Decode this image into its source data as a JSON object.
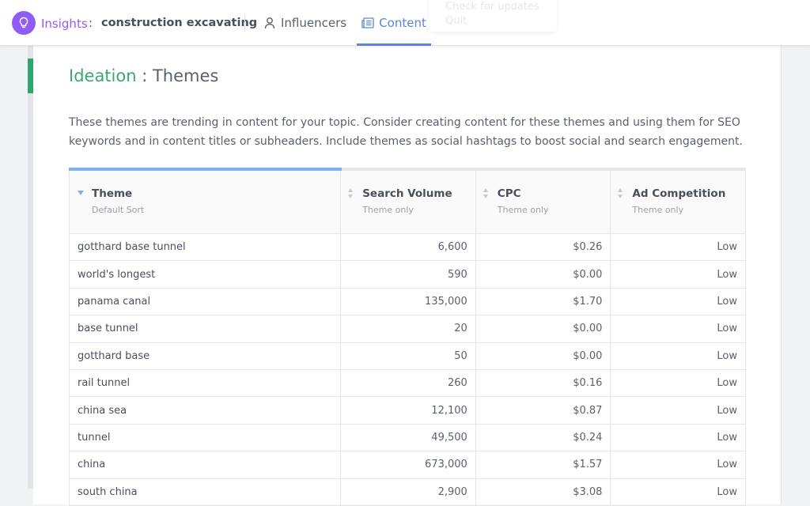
{
  "nav": {
    "app_name": "Insights",
    "separator": ":",
    "topic": "construction excavating",
    "tabs": [
      {
        "label": "Influencers",
        "icon": "person-icon",
        "active": false
      },
      {
        "label": "Content",
        "icon": "article-icon",
        "active": true
      }
    ],
    "ghost_menu": [
      "Check for updates",
      "Quit"
    ],
    "brand_color": "#8f5cf6",
    "active_color": "#5b86d6"
  },
  "section": {
    "title_prefix": "Ideation",
    "title_separator": " : ",
    "title": "Themes",
    "prefix_color": "#3aa876",
    "description": "These themes are trending in content for your topic. Consider creating content for these themes and using them for SEO keywords and in content titles or subheaders. Include themes as social hashtags to boost social and search engagement."
  },
  "table": {
    "columns": [
      {
        "label": "Theme",
        "sub": "Default Sort",
        "sort": "descending-active"
      },
      {
        "label": "Search Volume",
        "sub": "Theme only",
        "sort": "none"
      },
      {
        "label": "CPC",
        "sub": "Theme only",
        "sort": "none"
      },
      {
        "label": "Ad Competition",
        "sub": "Theme only",
        "sort": "none"
      }
    ],
    "rows": [
      [
        "gotthard base tunnel",
        "6,600",
        "$0.26",
        "Low"
      ],
      [
        "world's longest",
        "590",
        "$0.00",
        "Low"
      ],
      [
        "panama canal",
        "135,000",
        "$1.70",
        "Low"
      ],
      [
        "base tunnel",
        "20",
        "$0.00",
        "Low"
      ],
      [
        "gotthard base",
        "50",
        "$0.00",
        "Low"
      ],
      [
        "rail tunnel",
        "260",
        "$0.16",
        "Low"
      ],
      [
        "china sea",
        "12,100",
        "$0.87",
        "Low"
      ],
      [
        "tunnel",
        "49,500",
        "$0.24",
        "Low"
      ],
      [
        "china",
        "673,000",
        "$1.57",
        "Low"
      ],
      [
        "south china",
        "2,900",
        "$3.08",
        "Low"
      ]
    ]
  }
}
